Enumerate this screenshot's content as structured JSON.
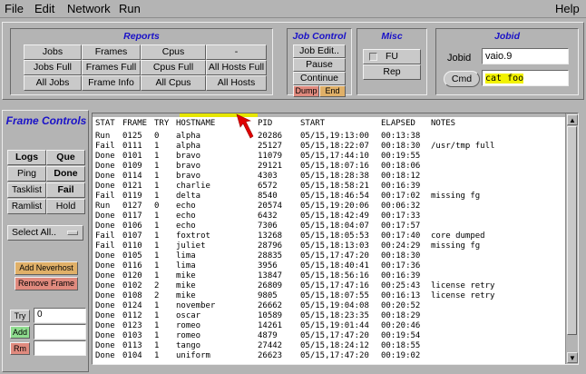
{
  "menubar": {
    "items": [
      "File",
      "Edit",
      "Network",
      "Run"
    ],
    "help": "Help"
  },
  "reports": {
    "title": "Reports",
    "buttons": [
      "Jobs",
      "Frames",
      "Cpus",
      "-",
      "Jobs Full",
      "Frames Full",
      "Cpus Full",
      "All Hosts Full",
      "All Jobs",
      "Frame Info",
      "All Cpus",
      "All Hosts"
    ]
  },
  "job_control": {
    "title": "Job Control",
    "job_edit": "Job Edit..",
    "pause": "Pause",
    "continue": "Continue",
    "dump": "Dump",
    "end": "End"
  },
  "misc": {
    "title": "Misc",
    "fu_label": "FU",
    "rep": "Rep"
  },
  "jobid": {
    "title": "Jobid",
    "label": "Jobid",
    "value": "vaio.9",
    "cmd_button": "Cmd",
    "cmd_value": "cat foo"
  },
  "frame_controls": {
    "title": "Frame Controls",
    "grid": [
      {
        "label": "Logs",
        "bold": true
      },
      {
        "label": "Que",
        "bold": true
      },
      {
        "label": "Ping",
        "bold": false
      },
      {
        "label": "Done",
        "bold": true
      },
      {
        "label": "Tasklist",
        "bold": false
      },
      {
        "label": "Fail",
        "bold": true
      },
      {
        "label": "Ramlist",
        "bold": false
      },
      {
        "label": "Hold",
        "bold": false
      }
    ],
    "select_all": "Select All..",
    "add_neverhost": "Add Neverhost",
    "remove_frame": "Remove Frame",
    "try_label": "Try",
    "try_value": "0",
    "add_label": "Add",
    "rm_label": "Rm"
  },
  "table": {
    "columns": [
      "STAT",
      "FRAME",
      "TRY",
      "HOSTNAME",
      "PID",
      "START",
      "ELAPSED",
      "NOTES"
    ],
    "rows": [
      [
        "Run",
        "0125",
        "0",
        "alpha",
        "20286",
        "05/15,19:13:00",
        "00:13:38",
        ""
      ],
      [
        "Fail",
        "0111",
        "1",
        "alpha",
        "25127",
        "05/15,18:22:07",
        "00:18:30",
        "/usr/tmp full"
      ],
      [
        "Done",
        "0101",
        "1",
        "bravo",
        "11079",
        "05/15,17:44:10",
        "00:19:55",
        ""
      ],
      [
        "Done",
        "0109",
        "1",
        "bravo",
        "29121",
        "05/15,18:07:16",
        "00:18:06",
        ""
      ],
      [
        "Done",
        "0114",
        "1",
        "bravo",
        "4303",
        "05/15,18:28:38",
        "00:18:12",
        ""
      ],
      [
        "Done",
        "0121",
        "1",
        "charlie",
        "6572",
        "05/15,18:58:21",
        "00:16:39",
        ""
      ],
      [
        "Fail",
        "0119",
        "1",
        "delta",
        "8540",
        "05/15,18:46:54",
        "00:17:02",
        "missing fg"
      ],
      [
        "Run",
        "0127",
        "0",
        "echo",
        "20574",
        "05/15,19:20:06",
        "00:06:32",
        ""
      ],
      [
        "Done",
        "0117",
        "1",
        "echo",
        "6432",
        "05/15,18:42:49",
        "00:17:33",
        ""
      ],
      [
        "Done",
        "0106",
        "1",
        "echo",
        "7306",
        "05/15,18:04:07",
        "00:17:57",
        ""
      ],
      [
        "Fail",
        "0107",
        "1",
        "foxtrot",
        "13268",
        "05/15,18:05:53",
        "00:17:40",
        "core dumped"
      ],
      [
        "Fail",
        "0110",
        "1",
        "juliet",
        "28796",
        "05/15,18:13:03",
        "00:24:29",
        "missing fg"
      ],
      [
        "Done",
        "0105",
        "1",
        "lima",
        "28835",
        "05/15,17:47:20",
        "00:18:30",
        ""
      ],
      [
        "Done",
        "0116",
        "1",
        "lima",
        "3956",
        "05/15,18:40:41",
        "00:17:36",
        ""
      ],
      [
        "Done",
        "0120",
        "1",
        "mike",
        "13847",
        "05/15,18:56:16",
        "00:16:39",
        ""
      ],
      [
        "Done",
        "0102",
        "2",
        "mike",
        "26809",
        "05/15,17:47:16",
        "00:25:43",
        "license retry"
      ],
      [
        "Done",
        "0108",
        "2",
        "mike",
        "9805",
        "05/15,18:07:55",
        "00:16:13",
        "license retry"
      ],
      [
        "Done",
        "0124",
        "1",
        "november",
        "26662",
        "05/15,19:04:08",
        "00:20:52",
        ""
      ],
      [
        "Done",
        "0112",
        "1",
        "oscar",
        "10589",
        "05/15,18:23:35",
        "00:18:29",
        ""
      ],
      [
        "Done",
        "0123",
        "1",
        "romeo",
        "14261",
        "05/15,19:01:44",
        "00:20:46",
        ""
      ],
      [
        "Done",
        "0103",
        "1",
        "romeo",
        "4879",
        "05/15,17:47:20",
        "00:19:54",
        ""
      ],
      [
        "Done",
        "0113",
        "1",
        "tango",
        "27442",
        "05/15,18:24:12",
        "00:18:55",
        ""
      ],
      [
        "Done",
        "0104",
        "1",
        "uniform",
        "26623",
        "05/15,17:47:20",
        "00:19:02",
        ""
      ]
    ]
  },
  "colors": {
    "title_blue": "#1a12c8",
    "dump_bg": "#e08a7e",
    "end_bg": "#e0b068",
    "add_neverhost_bg": "#e0b068",
    "remove_frame_bg": "#e08a7e",
    "cmd_highlight": "#f2f200",
    "add_btn_bg": "#8fdd8f",
    "rm_btn_bg": "#e08a7e",
    "scroll_marker": "#e6e600",
    "pointer_red": "#e00000"
  }
}
